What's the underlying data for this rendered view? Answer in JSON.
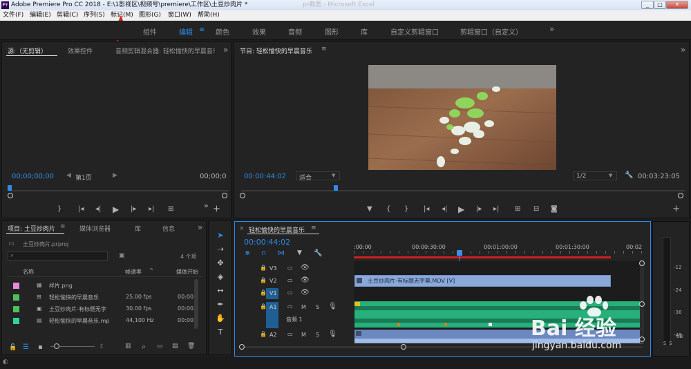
{
  "window": {
    "app_title": "Adobe Premiere Pro CC 2018 - E:\\1影视区\\视频号\\premiere\\工作区\\土豆炒肉片 *",
    "bg_title": "pr截图 - Microsoft Excel",
    "min": "_",
    "max": "□",
    "close": "✕"
  },
  "menu": [
    "文件(F)",
    "编辑(E)",
    "剪辑(C)",
    "序列(S)",
    "标记(M)",
    "图形(G)",
    "窗口(W)",
    "帮助(H)"
  ],
  "workspaces": [
    "组件",
    "编辑",
    "颜色",
    "效果",
    "音频",
    "图形",
    "库",
    "自定义剪辑窗口",
    "剪辑窗口（自定义）"
  ],
  "workspace_active_index": 1,
  "workspace_more": "»",
  "source": {
    "tabs": [
      "源:（无剪辑）",
      "效果控件",
      "音频剪辑混合器: 轻松愉快的早晨音乐"
    ],
    "timecode": "00;00;00;00",
    "page": "第1页",
    "timecode_right": "00;00;0",
    "more": "»"
  },
  "program": {
    "title": "节目: 轻松愉快的早晨音乐",
    "timecode": "00:00:44:02",
    "fit": "适合",
    "quality": "1/2",
    "duration": "00:03:23:05",
    "more": "»"
  },
  "project": {
    "tabs": [
      "项目: 土豆炒肉片",
      "媒体浏览器",
      "库",
      "信息"
    ],
    "more": "»",
    "file": "土豆炒肉片.prproj",
    "count": "4 个项",
    "search_placeholder": "",
    "columns": [
      "名称",
      "帧速率",
      "媒体开始"
    ],
    "rows": [
      {
        "name": "样片.png",
        "fps": "",
        "start": "",
        "color": "#e88ad6"
      },
      {
        "name": "轻松愉快的早晨音乐",
        "fps": "25.00 fps",
        "start": "00:00",
        "color": "#4fbf5e"
      },
      {
        "name": "土豆炒肉片-有标题无字",
        "fps": "30.00 fps",
        "start": "00:00",
        "color": "#4fbf5e"
      },
      {
        "name": "轻松愉快的早晨音乐.mp",
        "fps": "44,100 Hz",
        "start": "00:00",
        "color": "#2fd39a"
      }
    ]
  },
  "timeline": {
    "title": "轻松愉快的早晨音乐",
    "timecode": "00:00:44:02",
    "ruler": [
      ":00:00",
      "00:00:30:00",
      "00:01:00:00",
      "00:01:30:00",
      "00:02"
    ],
    "tracks": [
      {
        "label": "V3"
      },
      {
        "label": "V2"
      },
      {
        "label": "V1"
      },
      {
        "label": "A1",
        "name": "音频 1"
      },
      {
        "label": "A2"
      }
    ],
    "clip_v2": "土豆炒肉片-有标题无字幕.MOV [V]",
    "track_m": "M",
    "track_s": "S"
  },
  "meter": {
    "labels": [
      "-12",
      "-24",
      "-36",
      "-48"
    ],
    "db": "dB",
    "s1": "S",
    "s2": "S"
  },
  "watermark": {
    "brand": "Bai  经验",
    "url": "jingyan.baidu.com"
  },
  "colors": {
    "accent": "#2d8ceb",
    "playhead": "#3f8ef0",
    "clip": "#8aa8d8",
    "audio": "#27b07a",
    "red_bar": "#d02020"
  }
}
